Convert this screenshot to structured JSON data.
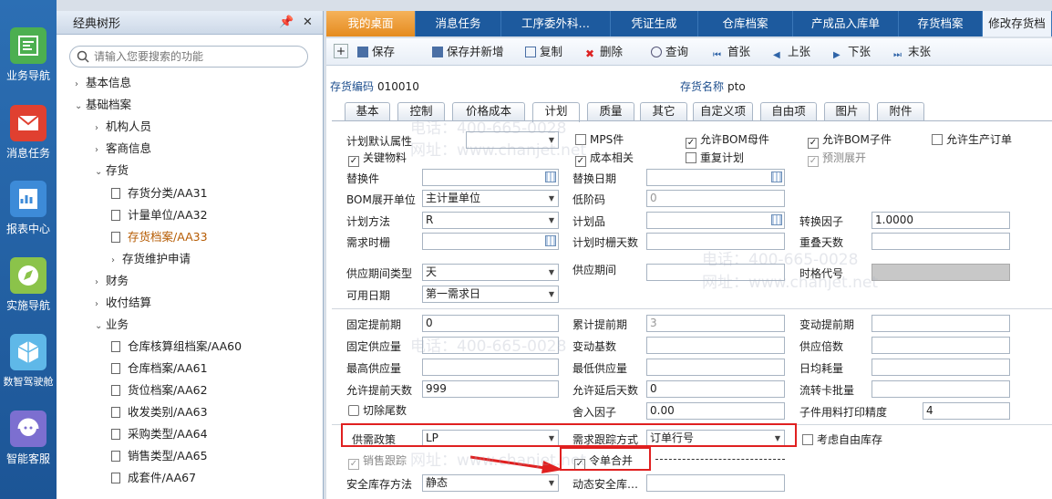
{
  "sidebar": {
    "items": [
      {
        "label": "业务导航",
        "icon": "business-nav-icon",
        "color": "#4caf50"
      },
      {
        "label": "消息任务",
        "icon": "message-task-icon",
        "color": "#e04030"
      },
      {
        "label": "报表中心",
        "icon": "report-center-icon",
        "color": "#3d8bd8"
      },
      {
        "label": "实施导航",
        "icon": "implementation-nav-icon",
        "color": "#8bc34a"
      },
      {
        "label": "数智驾驶舱",
        "icon": "dashboard-icon",
        "color": "#5fb8e8"
      },
      {
        "label": "智能客服",
        "icon": "smart-service-icon",
        "color": "#7c6fd0"
      }
    ]
  },
  "tree": {
    "title": "经典树形",
    "search_placeholder": "请输入您要搜索的功能",
    "nodes": [
      {
        "label": "基本信息",
        "arrow": "›"
      },
      {
        "label": "基础档案",
        "arrow": "⌄"
      },
      {
        "label": "机构人员",
        "arrow": "›"
      },
      {
        "label": "客商信息",
        "arrow": "›"
      },
      {
        "label": "存货",
        "arrow": "⌄"
      },
      {
        "label": "存货分类/AA31"
      },
      {
        "label": "计量单位/AA32"
      },
      {
        "label": "存货档案/AA33"
      },
      {
        "label": "存货维护申请",
        "arrow": "›"
      },
      {
        "label": "财务",
        "arrow": "›"
      },
      {
        "label": "收付结算",
        "arrow": "›"
      },
      {
        "label": "业务",
        "arrow": "⌄"
      },
      {
        "label": "仓库核算组档案/AA60"
      },
      {
        "label": "仓库档案/AA61"
      },
      {
        "label": "货位档案/AA62"
      },
      {
        "label": "收发类别/AA63"
      },
      {
        "label": "采购类型/AA64"
      },
      {
        "label": "销售类型/AA65"
      },
      {
        "label": "成套件/AA67"
      }
    ]
  },
  "tabs": [
    "我的桌面",
    "消息任务",
    "工序委外科…",
    "凭证生成",
    "仓库档案",
    "产成品入库单",
    "存货档案",
    "修改存货档"
  ],
  "toolbar": {
    "save": "保存",
    "save_new": "保存并新增",
    "copy": "复制",
    "delete": "删除",
    "query": "查询",
    "first": "首张",
    "prev": "上张",
    "next": "下张",
    "last": "末张"
  },
  "header": {
    "code_label": "存货编码",
    "code_value": "010010",
    "name_label": "存货名称",
    "name_value": "pto"
  },
  "subtabs": [
    "基本",
    "控制",
    "价格成本",
    "计划",
    "质量",
    "其它",
    "自定义项",
    "自由项",
    "图片",
    "附件"
  ],
  "form": {
    "plan_default_attr": "计划默认属性",
    "mps": "MPS件",
    "allow_bom_parent": "允许BOM母件",
    "allow_bom_child": "允许BOM子件",
    "allow_prod_order": "允许生产订单",
    "key_material": "关键物料",
    "cost_related": "成本相关",
    "repeat_plan": "重复计划",
    "forecast_expand": "预测展开",
    "substitute": "替换件",
    "substitute_date": "替换日期",
    "bom_unit_label": "BOM展开单位",
    "bom_unit_value": "主计量单位",
    "low_level_code": "低阶码",
    "low_level_code_value": "0",
    "plan_method": "计划方法",
    "plan_method_value": "R",
    "plan_item": "计划品",
    "conv_factor": "转换因子",
    "conv_factor_value": "1.0000",
    "demand_fence": "需求时栅",
    "plan_fence_days": "计划时栅天数",
    "overlap_days": "重叠天数",
    "supply_period_type": "供应期间类型",
    "supply_period_type_value": "天",
    "supply_period": "供应期间",
    "time_bucket_code": "时格代号",
    "available_date": "可用日期",
    "available_date_value": "第一需求日",
    "fixed_lead": "固定提前期",
    "fixed_lead_value": "0",
    "cum_lead": "累计提前期",
    "cum_lead_value": "3",
    "var_lead": "变动提前期",
    "fixed_supply": "固定供应量",
    "var_base": "变动基数",
    "supply_multiple": "供应倍数",
    "max_supply": "最高供应量",
    "min_supply": "最低供应量",
    "daily_consumption": "日均耗量",
    "allow_early_days": "允许提前天数",
    "allow_early_days_value": "999",
    "allow_late_days": "允许延后天数",
    "allow_late_days_value": "0",
    "transfer_batch": "流转卡批量",
    "cut_tail": "切除尾数",
    "rounding": "舍入因子",
    "rounding_value": "0.00",
    "child_print_precision": "子件用料打印精度",
    "child_print_precision_value": "4",
    "supply_policy": "供需政策",
    "supply_policy_value": "LP",
    "demand_track": "需求跟踪方式",
    "demand_track_value": "订单行号",
    "consider_free_stock": "考虑自由库存",
    "sales_track": "销售跟踪",
    "order_merge": "令单合并",
    "safety_method": "安全库存方法",
    "safety_method_value": "静态",
    "dynamic_safety": "动态安全库…"
  },
  "watermark": {
    "phone": "电话：400-665-0028",
    "site": "网址：www.chanjet.net"
  },
  "colors": {
    "accent": "#1d5a9e",
    "active_tab": "#e58b1f",
    "highlight": "#e02020"
  }
}
